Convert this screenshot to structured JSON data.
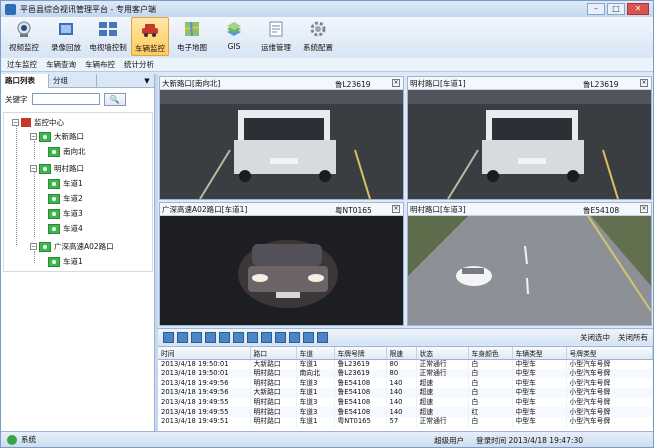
{
  "window": {
    "title": "平邑县综合视讯管理平台 - 专用客户端",
    "minimize": "–",
    "maximize": "□",
    "close": "✕"
  },
  "toolbar": {
    "items": [
      {
        "label": "视频监控",
        "icon": "webcam-icon"
      },
      {
        "label": "录像回放",
        "icon": "film-icon"
      },
      {
        "label": "电视墙控制",
        "icon": "tv-wall-icon"
      },
      {
        "label": "车辆监控",
        "icon": "car-icon"
      },
      {
        "label": "电子地图",
        "icon": "map-icon"
      },
      {
        "label": "GIS",
        "icon": "gis-icon"
      },
      {
        "label": "运维管理",
        "icon": "ops-icon"
      },
      {
        "label": "系统配置",
        "icon": "gear-icon"
      }
    ]
  },
  "submenu": {
    "items": [
      "过车监控",
      "车辆查询",
      "车辆布控",
      "统计分析"
    ]
  },
  "left": {
    "tabs": [
      "路口列表",
      "分组"
    ],
    "search_label": "关键字",
    "search_value": "",
    "search_button": "🔍",
    "tree": {
      "root": "监控中心",
      "groups": [
        {
          "name": "大新路口",
          "children": [
            "南向北"
          ]
        },
        {
          "name": "明村路口",
          "children": [
            "车道1",
            "车道2",
            "车道3",
            "车道4"
          ]
        },
        {
          "name": "广深高速A02路口",
          "children": [
            "车道1"
          ]
        }
      ]
    }
  },
  "videos": [
    {
      "title": "大新路口[南向北]",
      "plate": "鲁L23619"
    },
    {
      "title": "明村路口[车道1]",
      "plate": "鲁L23619"
    },
    {
      "title": "广深高速A02路口[车道1]",
      "plate": "粤NT0165"
    },
    {
      "title": "明村路口[车道3]",
      "plate": "鲁E54108"
    }
  ],
  "controls": {
    "focus": "关闭选中",
    "close_all": "关闭所有"
  },
  "table": {
    "columns": [
      "时间",
      "路口",
      "车道",
      "车牌号牌",
      "限速",
      "状态",
      "车身颜色",
      "车辆类型",
      "号牌类型"
    ],
    "rows": [
      [
        "2013/4/18 19:50:01",
        "大新路口",
        "车道1",
        "鲁L23619",
        "80",
        "正常通行",
        "白",
        "中型车",
        "小型汽车号牌"
      ],
      [
        "2013/4/18 19:50:01",
        "明村路口",
        "南向北",
        "鲁L23619",
        "80",
        "正常通行",
        "白",
        "中型车",
        "小型汽车号牌"
      ],
      [
        "2013/4/18 19:49:56",
        "明村路口",
        "车道3",
        "鲁E54108",
        "140",
        "超速",
        "白",
        "中型车",
        "小型汽车号牌"
      ],
      [
        "2013/4/18 19:49:56",
        "大新路口",
        "车道1",
        "鲁E54108",
        "140",
        "超速",
        "白",
        "中型车",
        "小型汽车号牌"
      ],
      [
        "2013/4/18 19:49:55",
        "明村路口",
        "车道3",
        "鲁E54108",
        "140",
        "超速",
        "白",
        "中型车",
        "小型汽车号牌"
      ],
      [
        "2013/4/18 19:49:55",
        "明村路口",
        "车道3",
        "鲁E54108",
        "140",
        "超速",
        "红",
        "中型车",
        "小型汽车号牌"
      ],
      [
        "2013/4/18 19:49:51",
        "明村路口",
        "车道1",
        "粤NT0165",
        "57",
        "正常通行",
        "白",
        "中型车",
        "小型汽车号牌"
      ]
    ]
  },
  "status": {
    "system": "系统",
    "user": "超级用户",
    "time": "登录时间 2013/4/18 19:47:30"
  }
}
